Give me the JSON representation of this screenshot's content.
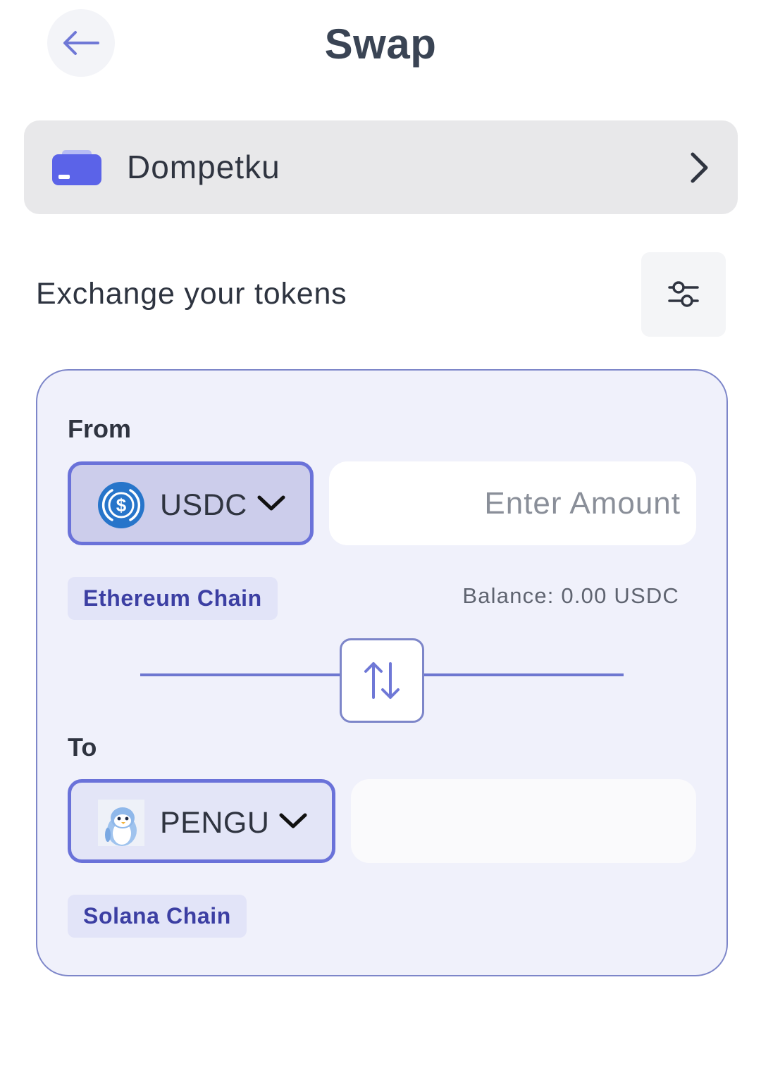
{
  "header": {
    "title": "Swap",
    "back_icon": "arrow-left-icon"
  },
  "wallet": {
    "name": "Dompetku",
    "icon": "wallet-icon",
    "chevron_icon": "chevron-right-icon"
  },
  "exchange": {
    "title": "Exchange your tokens",
    "settings_icon": "sliders-icon"
  },
  "swap": {
    "from": {
      "label": "From",
      "token": "USDC",
      "token_icon": "usdc-logo-icon",
      "amount_placeholder": "Enter Amount",
      "amount_value": "",
      "chain": "Ethereum Chain",
      "balance": "Balance: 0.00 USDC"
    },
    "switch_icon": "swap-arrows-icon",
    "to": {
      "label": "To",
      "token": "PENGU",
      "token_icon": "pengu-logo-icon",
      "amount_value": "",
      "chain": "Solana Chain"
    }
  },
  "colors": {
    "accent": "#6a72d9",
    "card_bg": "#f0f1fb",
    "badge_text": "#3c3fa3",
    "usdc_blue": "#2775ca"
  }
}
